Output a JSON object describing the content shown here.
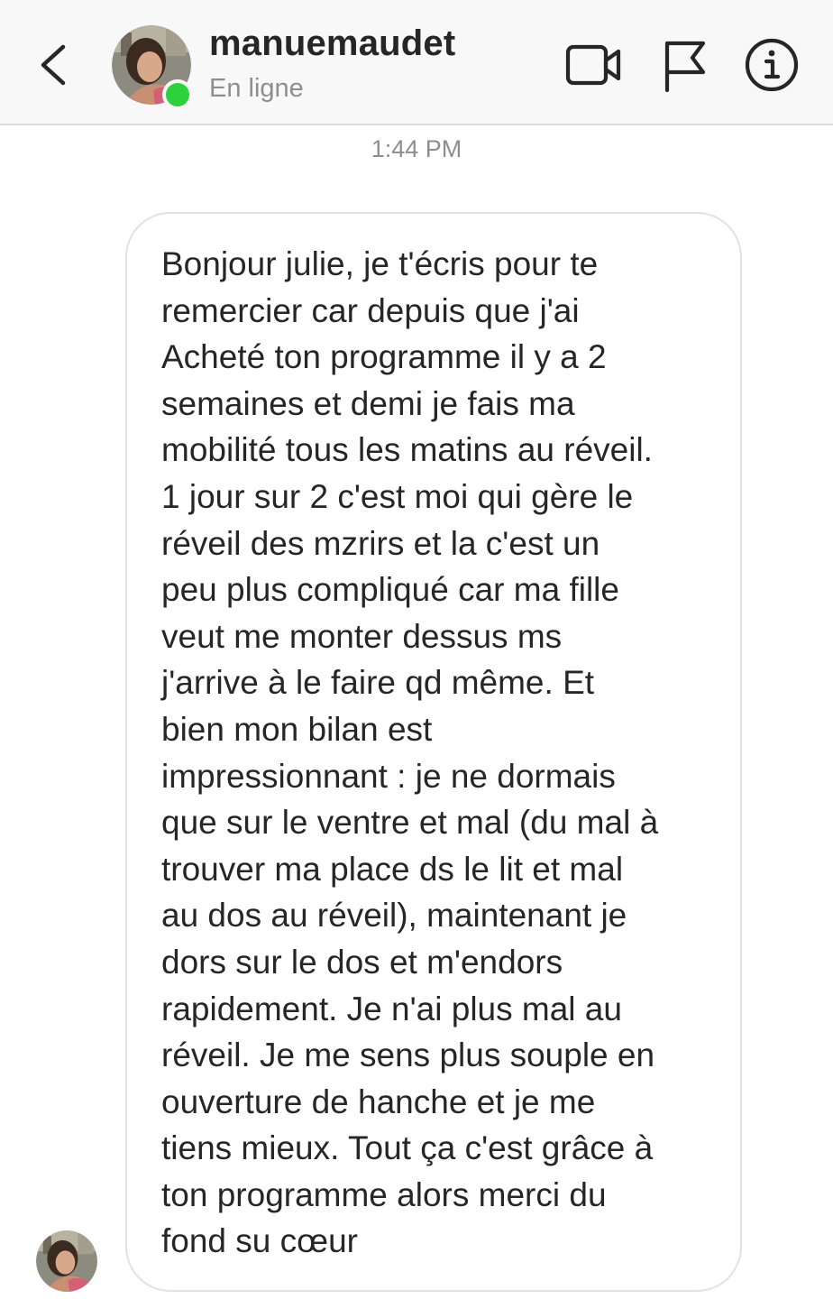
{
  "header": {
    "username": "manuemaudet",
    "status": "En ligne",
    "icons": {
      "back": "chevron-left-icon",
      "video": "video-camera-icon",
      "flag": "flag-icon",
      "info": "info-icon"
    },
    "online_color": "#2dd23a"
  },
  "conversation": {
    "timestamp": "1:44 PM",
    "message": "Bonjour julie, je t'écris pour te\nremercier car depuis que j'ai\nAcheté ton programme il y a 2\nsemaines et demi je fais ma\nmobilité tous les matins au réveil.\n1 jour sur 2 c'est moi qui gère le\nréveil des mzrirs et la c'est un\npeu plus compliqué car ma fille\nveut me monter dessus ms\nj'arrive à le faire qd même. Et\nbien mon bilan est\nimpressionnant : je ne dormais\nque sur le ventre et mal (du mal à\ntrouver ma place ds le lit et mal\nau dos au réveil), maintenant je\ndors sur le dos et m'endors\nrapidement. Je n'ai plus mal au\nréveil. Je me sens plus souple en\nouverture de hanche et je me\ntiens mieux. Tout ça c'est grâce à\nton programme alors merci du\nfond su cœur"
  }
}
